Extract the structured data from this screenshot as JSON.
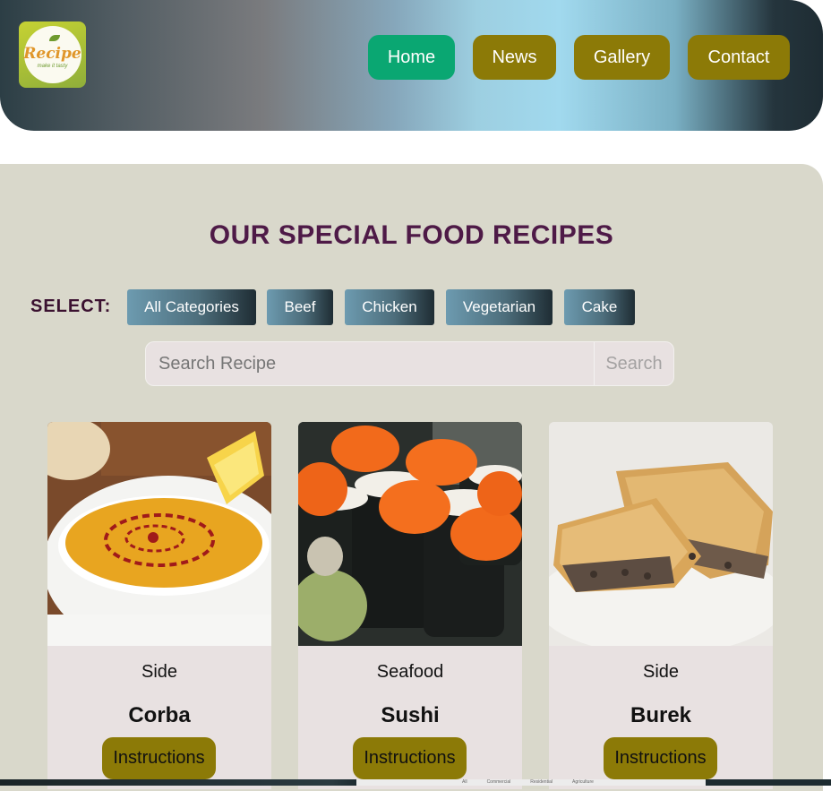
{
  "logo": {
    "word": "Recipe",
    "tagline": "make it tasty"
  },
  "nav": [
    {
      "label": "Home",
      "active": true
    },
    {
      "label": "News",
      "active": false
    },
    {
      "label": "Gallery",
      "active": false
    },
    {
      "label": "Contact",
      "active": false
    }
  ],
  "main": {
    "title": "OUR SPECIAL FOOD RECIPES",
    "select_label": "SELECT:",
    "categories": [
      "All Categories",
      "Beef",
      "Chicken",
      "Vegetarian",
      "Cake"
    ],
    "search": {
      "placeholder": "Search Recipe",
      "button_label": "Search"
    }
  },
  "cards": [
    {
      "category": "Side",
      "name": "Corba",
      "button": "Instructions"
    },
    {
      "category": "Seafood",
      "name": "Sushi",
      "button": "Instructions"
    },
    {
      "category": "Side",
      "name": "Burek",
      "button": "Instructions"
    }
  ],
  "footer_tabs": [
    "All",
    "Commercial",
    "Residential",
    "Agriculture"
  ],
  "colors": {
    "nav_active": "#0aa772",
    "nav_default": "#8c7a07",
    "title": "#4e1a47",
    "panel_bg": "#d9d8cb",
    "card_bg": "#e8e1e1"
  }
}
